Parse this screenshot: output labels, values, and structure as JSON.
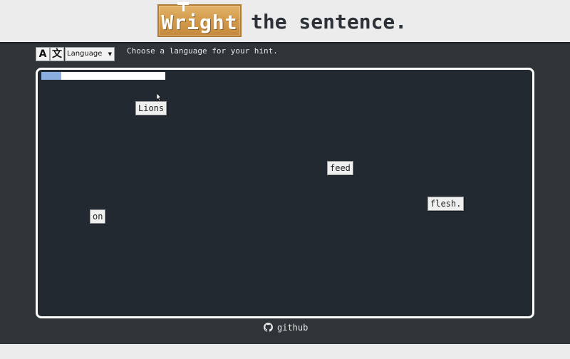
{
  "header": {
    "logo_text": "Wright",
    "tagline": "the sentence."
  },
  "toolbar": {
    "font_button_label": "A",
    "translate_icon_glyph": "文",
    "language_select": "Language",
    "hint_text": "Choose a language for your hint."
  },
  "board": {
    "progress_fraction": 0.16,
    "words": [
      "Lions",
      "feed",
      "flesh.",
      "on"
    ]
  },
  "footer": {
    "link_label": "github",
    "icon": "github-icon"
  },
  "colors": {
    "page_bg": "#ececec",
    "main_bg": "#2f3439",
    "board_bg": "#232930",
    "progress_fill": "#8aaee0",
    "logo_wood": "#d39c4d"
  }
}
